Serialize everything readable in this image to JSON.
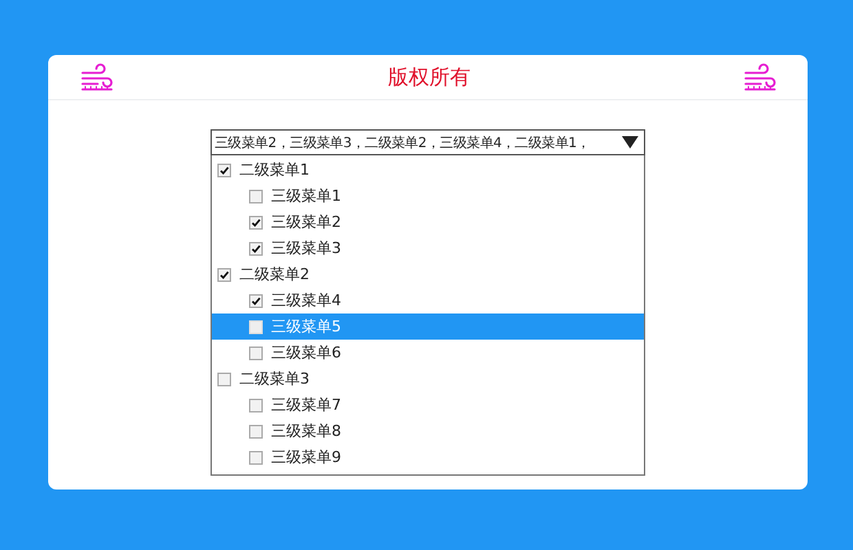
{
  "header": {
    "title": "版权所有"
  },
  "tree_select": {
    "value": "三级菜单2，三级菜单3，二级菜单2，三级菜单4，二级菜单1，",
    "expanded": true,
    "items": [
      {
        "label": "二级菜单1",
        "checked": true,
        "selected": false,
        "children": [
          {
            "label": "三级菜单1",
            "checked": false,
            "selected": false
          },
          {
            "label": "三级菜单2",
            "checked": true,
            "selected": false
          },
          {
            "label": "三级菜单3",
            "checked": true,
            "selected": false
          }
        ]
      },
      {
        "label": "二级菜单2",
        "checked": true,
        "selected": false,
        "children": [
          {
            "label": "三级菜单4",
            "checked": true,
            "selected": false
          },
          {
            "label": "三级菜单5",
            "checked": false,
            "selected": true
          },
          {
            "label": "三级菜单6",
            "checked": false,
            "selected": false
          }
        ]
      },
      {
        "label": "二级菜单3",
        "checked": false,
        "selected": false,
        "children": [
          {
            "label": "三级菜单7",
            "checked": false,
            "selected": false
          },
          {
            "label": "三级菜单8",
            "checked": false,
            "selected": false
          },
          {
            "label": "三级菜单9",
            "checked": false,
            "selected": false
          }
        ]
      }
    ]
  }
}
